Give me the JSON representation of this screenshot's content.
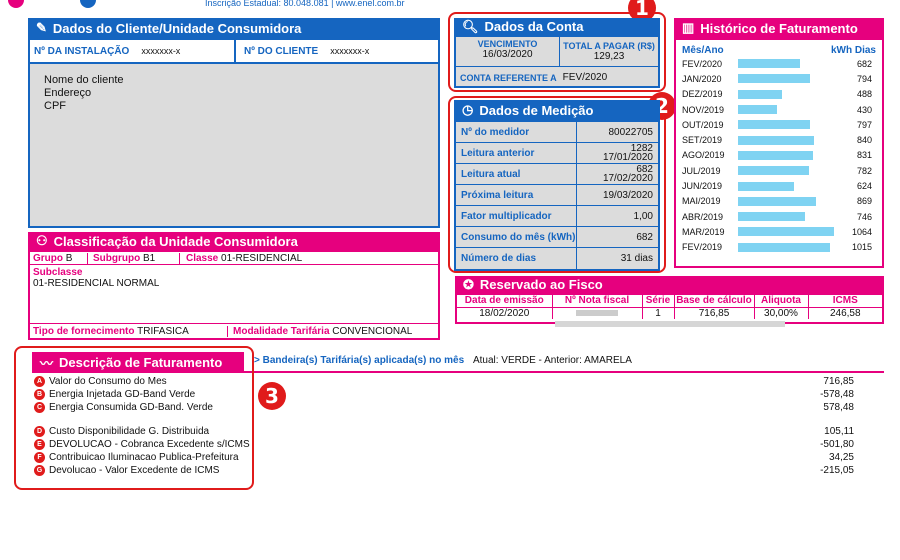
{
  "header": {
    "inscricao": "Inscrição Estadual: 80.048.081 | www.enel.com.br"
  },
  "cliente": {
    "title": "Dados do Cliente/Unidade Consumidora",
    "instalacao_label": "Nº DA INSTALAÇÃO",
    "instalacao_value": "xxxxxxx-x",
    "cliente_label": "Nº DO CLIENTE",
    "cliente_value": "xxxxxxx-x",
    "nome": "Nome do cliente",
    "endereco": "Endereço",
    "cpf": "CPF"
  },
  "conta": {
    "title": "Dados da Conta",
    "vencimento_label": "VENCIMENTO",
    "vencimento_value": "16/03/2020",
    "total_label": "TOTAL A PAGAR (R$)",
    "total_value": "129,23",
    "referente_label": "CONTA REFERENTE A",
    "referente_value": "FEV/2020"
  },
  "medicao": {
    "title": "Dados de Medição",
    "rows": [
      {
        "k": "Nº do medidor",
        "v1": "80022705",
        "v2": ""
      },
      {
        "k": "Leitura anterior",
        "v1": "1282",
        "v2": "17/01/2020"
      },
      {
        "k": "Leitura atual",
        "v1": "682",
        "v2": "17/02/2020"
      },
      {
        "k": "Próxima leitura",
        "v1": "19/03/2020",
        "v2": ""
      },
      {
        "k": "Fator multiplicador",
        "v1": "1,00",
        "v2": ""
      },
      {
        "k": "Consumo do mês (kWh)",
        "v1": "682",
        "v2": ""
      },
      {
        "k": "Número de dias",
        "v1": "31 dias",
        "v2": ""
      }
    ]
  },
  "historico": {
    "title": "Histórico de Faturamento",
    "col_mes": "Mês/Ano",
    "col_kwh": "kWh Dias",
    "max": 1064,
    "rows": [
      {
        "mes": "FEV/2020",
        "kwh": 682
      },
      {
        "mes": "JAN/2020",
        "kwh": 794
      },
      {
        "mes": "DEZ/2019",
        "kwh": 488
      },
      {
        "mes": "NOV/2019",
        "kwh": 430
      },
      {
        "mes": "OUT/2019",
        "kwh": 797
      },
      {
        "mes": "SET/2019",
        "kwh": 840
      },
      {
        "mes": "AGO/2019",
        "kwh": 831
      },
      {
        "mes": "JUL/2019",
        "kwh": 782
      },
      {
        "mes": "JUN/2019",
        "kwh": 624
      },
      {
        "mes": "MAI/2019",
        "kwh": 869
      },
      {
        "mes": "ABR/2019",
        "kwh": 746
      },
      {
        "mes": "MAR/2019",
        "kwh": 1064
      },
      {
        "mes": "FEV/2019",
        "kwh": 1015
      }
    ]
  },
  "classificacao": {
    "title": "Classificação da Unidade Consumidora",
    "grupo_label": "Grupo",
    "grupo_value": "B",
    "subgrupo_label": "Subgrupo",
    "subgrupo_value": "B1",
    "classe_label": "Classe",
    "classe_value": "01-RESIDENCIAL",
    "subclasse_label": "Subclasse",
    "subclasse_value": "01-RESIDENCIAL NORMAL",
    "fornecimento_label": "Tipo de fornecimento",
    "fornecimento_value": "TRIFASICA",
    "modalidade_label": "Modalidade Tarifária",
    "modalidade_value": "CONVENCIONAL"
  },
  "fisco": {
    "title": "Reservado ao Fisco",
    "headers": [
      "Data de emissão",
      "Nº Nota fiscal",
      "Série",
      "Base de cálculo",
      "Aliquota",
      "ICMS"
    ],
    "values": [
      "18/02/2020",
      "",
      "1",
      "716,85",
      "30,00%",
      "246,58"
    ]
  },
  "faturamento": {
    "title": "Descrição de Faturamento",
    "bandeira_label": "Bandeira(s) Tarifária(s) aplicada(s) no mês",
    "bandeira_value": "Atual: VERDE - Anterior: AMARELA",
    "items_a": [
      {
        "letter": "A",
        "desc": "Valor do Consumo do Mes",
        "value": "716,85"
      },
      {
        "letter": "B",
        "desc": "Energia Injetada GD-Band Verde",
        "value": "-578,48"
      },
      {
        "letter": "C",
        "desc": "Energia Consumida GD-Band. Verde",
        "value": "578,48"
      }
    ],
    "items_b": [
      {
        "letter": "D",
        "desc": "Custo Disponibilidade G. Distribuida",
        "value": "105,11"
      },
      {
        "letter": "E",
        "desc": "DEVOLUCAO - Cobranca Excedente s/ICMS",
        "value": "-501,80"
      },
      {
        "letter": "F",
        "desc": "Contribuicao Iluminacao Publica-Prefeitura",
        "value": "34,25"
      },
      {
        "letter": "G",
        "desc": "Devolucao - Valor Excedente de ICMS",
        "value": "-215,05"
      }
    ]
  },
  "badges": {
    "one": "1",
    "two": "2",
    "three": "3"
  },
  "colors": {
    "blue": "#1565c0",
    "pink": "#e6007e",
    "red": "#e01b1b",
    "bar": "#7fd3f2"
  }
}
